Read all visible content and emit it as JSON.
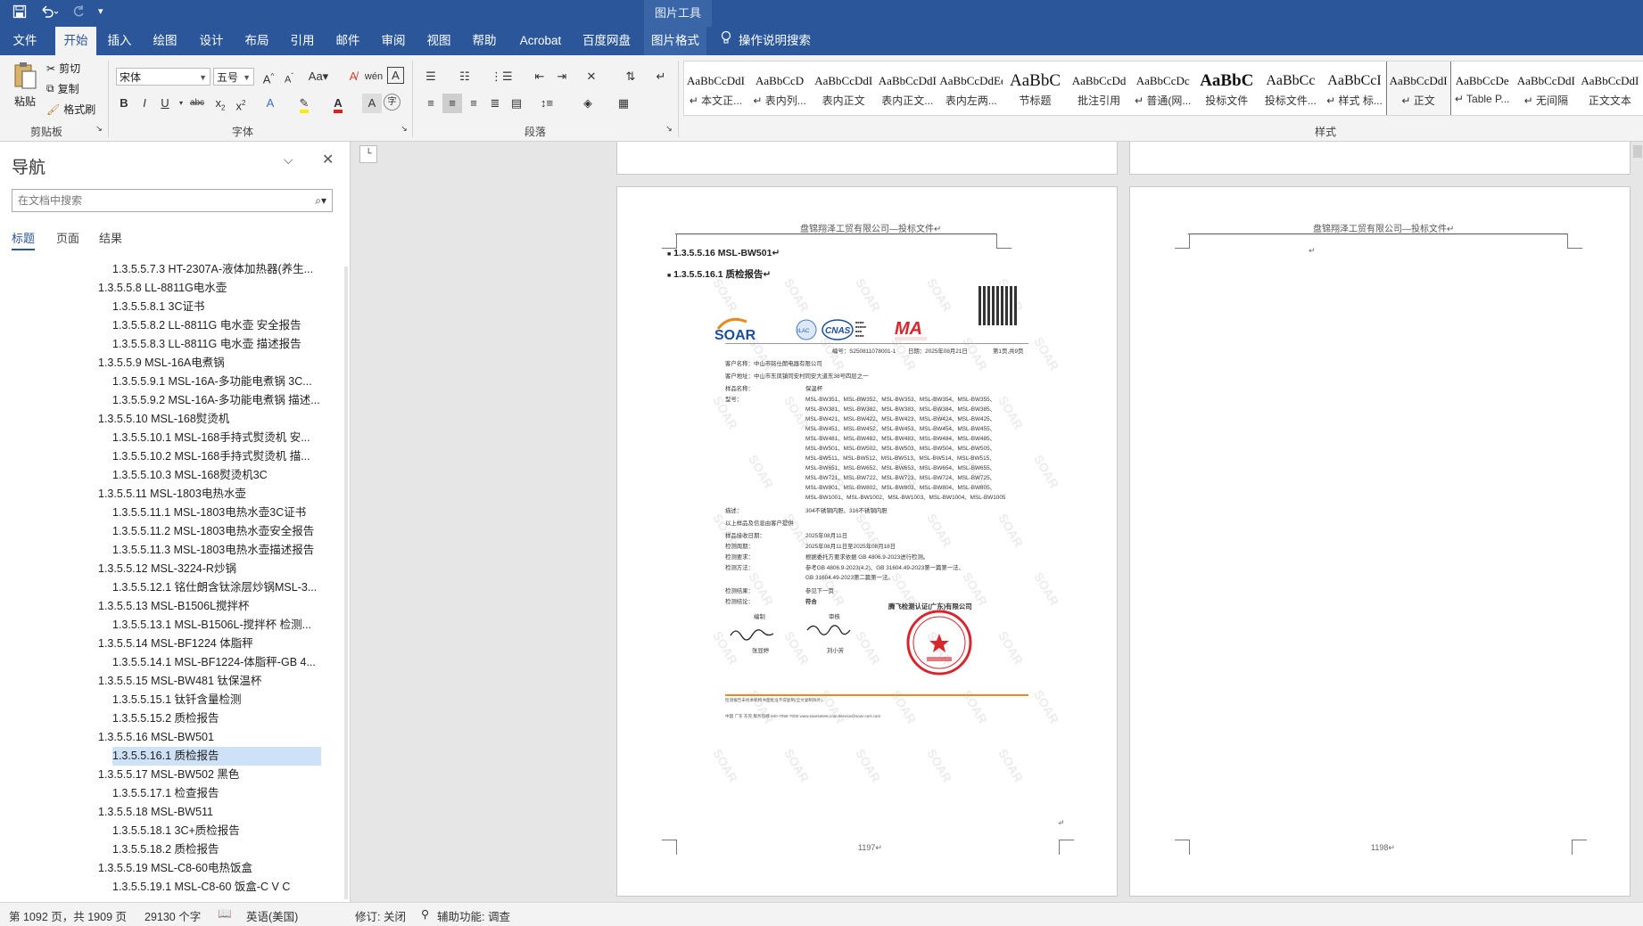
{
  "window": {
    "context_tab_group": "图片工具",
    "quick_access": [
      "save-icon",
      "undo-icon",
      "redo-icon",
      "customize-icon"
    ]
  },
  "tabs": [
    "文件",
    "开始",
    "插入",
    "绘图",
    "设计",
    "布局",
    "引用",
    "邮件",
    "审阅",
    "视图",
    "帮助",
    "Acrobat",
    "百度网盘",
    "图片格式"
  ],
  "tell_me": "操作说明搜索",
  "ribbon": {
    "clipboard": {
      "paste": "粘贴",
      "cut": "剪切",
      "copy": "复制",
      "format_painter": "格式刷",
      "label": "剪贴板"
    },
    "font": {
      "name": "宋体",
      "size": "五号",
      "label": "字体"
    },
    "paragraph": {
      "label": "段落"
    },
    "styles": {
      "label": "样式",
      "items": [
        {
          "preview": "AaBbCcDdI",
          "name": "↵ 本文正..."
        },
        {
          "preview": "AaBbCcD",
          "name": "↵ 表内列..."
        },
        {
          "preview": "AaBbCcDdI",
          "name": "表内正文"
        },
        {
          "preview": "AaBbCcDdI",
          "name": "表内正文..."
        },
        {
          "preview": "AaBbCcDdEe",
          "name": "表内左两..."
        },
        {
          "preview": "AaBbC",
          "name": "节标题"
        },
        {
          "preview": "AaBbCcDd",
          "name": "批注引用"
        },
        {
          "preview": "AaBbCcDc",
          "name": "↵ 普通(网..."
        },
        {
          "preview": "AaBbC",
          "name": "投标文件"
        },
        {
          "preview": "AaBbCc",
          "name": "投标文件..."
        },
        {
          "preview": "AaBbCcI",
          "name": "↵ 样式 标..."
        },
        {
          "preview": "AaBbCcDdI",
          "name": "↵ 正文"
        },
        {
          "preview": "AaBbCcDe",
          "name": "↵ Table P..."
        },
        {
          "preview": "AaBbCcDdI",
          "name": "↵ 无间隔"
        },
        {
          "preview": "AaBbCcDdI",
          "name": "正文文本"
        }
      ]
    }
  },
  "nav": {
    "title": "导航",
    "search_placeholder": "在文档中搜索",
    "tabs": [
      "标题",
      "页面",
      "结果"
    ],
    "items": [
      {
        "text": "1.3.5.5.7.3 HT-2307A-液体加热器(养生...",
        "level": 2
      },
      {
        "text": "1.3.5.5.8 LL-8811G电水壶",
        "level": 1
      },
      {
        "text": "1.3.5.5.8.1 3C证书",
        "level": 2
      },
      {
        "text": "1.3.5.5.8.2 LL-8811G 电水壶 安全报告",
        "level": 2
      },
      {
        "text": "1.3.5.5.8.3 LL-8811G 电水壶 描述报告",
        "level": 2
      },
      {
        "text": "1.3.5.5.9 MSL-16A电煮锅",
        "level": 1
      },
      {
        "text": "1.3.5.5.9.1 MSL-16A-多功能电煮锅 3C...",
        "level": 2
      },
      {
        "text": "1.3.5.5.9.2 MSL-16A-多功能电煮锅 描述...",
        "level": 2
      },
      {
        "text": "1.3.5.5.10 MSL-168熨烫机",
        "level": 1
      },
      {
        "text": "1.3.5.5.10.1 MSL-168手持式熨烫机 安...",
        "level": 2
      },
      {
        "text": "1.3.5.5.10.2 MSL-168手持式熨烫机 描...",
        "level": 2
      },
      {
        "text": "1.3.5.5.10.3 MSL-168熨烫机3C",
        "level": 2
      },
      {
        "text": "1.3.5.5.11 MSL-1803电热水壶",
        "level": 1
      },
      {
        "text": "1.3.5.5.11.1 MSL-1803电热水壶3C证书",
        "level": 2
      },
      {
        "text": "1.3.5.5.11.2 MSL-1803电热水壶安全报告",
        "level": 2
      },
      {
        "text": "1.3.5.5.11.3 MSL-1803电热水壶描述报告",
        "level": 2
      },
      {
        "text": "1.3.5.5.12 MSL-3224-R炒锅",
        "level": 1
      },
      {
        "text": "1.3.5.5.12.1 铭仕朗含钛涂层炒锅MSL-3...",
        "level": 2
      },
      {
        "text": "1.3.5.5.13 MSL-B1506L搅拌杯",
        "level": 1
      },
      {
        "text": "1.3.5.5.13.1 MSL-B1506L-搅拌杯 检测...",
        "level": 2
      },
      {
        "text": "1.3.5.5.14 MSL-BF1224 体脂秤",
        "level": 1
      },
      {
        "text": "1.3.5.5.14.1 MSL-BF1224-体脂秤-GB 4...",
        "level": 2
      },
      {
        "text": "1.3.5.5.15 MSL-BW481 钛保温杯",
        "level": 1
      },
      {
        "text": "1.3.5.5.15.1 钛钎含量检测",
        "level": 2
      },
      {
        "text": "1.3.5.5.15.2 质检报告",
        "level": 2
      },
      {
        "text": "1.3.5.5.16 MSL-BW501",
        "level": 1
      },
      {
        "text": "1.3.5.5.16.1 质检报告",
        "level": 2,
        "selected": true
      },
      {
        "text": "1.3.5.5.17 MSL-BW502 黑色",
        "level": 1
      },
      {
        "text": "1.3.5.5.17.1 检查报告",
        "level": 2
      },
      {
        "text": "1.3.5.5.18 MSL-BW511",
        "level": 1
      },
      {
        "text": "1.3.5.5.18.1 3C+质检报告",
        "level": 2
      },
      {
        "text": "1.3.5.5.18.2 质检报告",
        "level": 2
      },
      {
        "text": "1.3.5.5.19 MSL-C8-60电热饭盒",
        "level": 1
      },
      {
        "text": "1.3.5.5.19.1 MSL-C8-60 饭盒-C V C",
        "level": 2
      }
    ]
  },
  "document": {
    "header_text": "盘锦翔泽工贸有限公司—投标文件↵",
    "heading1": "1.3.5.5.16 MSL-BW501↵",
    "heading2": "1.3.5.5.16.1  质检报告↵",
    "page_left_number": "1197↵",
    "page_right_number": "1198↵",
    "empty_para": "↵",
    "cert": {
      "brand": "SOAR",
      "watermark": "SOAR",
      "report_no": "编号：S250811078001-1",
      "date": "日期：2025年08月21日",
      "page": "第1页,共9页",
      "client": "客户名称：中山市铭仕朗电器有限公司",
      "address": "客户地址：中山市东凤镇同安村同安大道东38号四层之一",
      "sample_name_label": "样品名称：",
      "sample_name": "保温杯",
      "model_label": "型号：",
      "models": [
        "MSL-BW351、MSL-BW352、MSL-BW353、MSL-BW354、MSL-BW355、",
        "MSL-BW381、MSL-BW382、MSL-BW383、MSL-BW384、MSL-BW385、",
        "MSL-BW421、MSL-BW422、MSL-BW423、MSL-BW424、MSL-BW425、",
        "MSL-BW451、MSL-BW452、MSL-BW453、MSL-BW454、MSL-BW455、",
        "MSL-BW481、MSL-BW482、MSL-BW483、MSL-BW484、MSL-BW485、",
        "MSL-BW501、MSL-BW502、MSL-BW503、MSL-BW504、MSL-BW505、",
        "MSL-BW511、MSL-BW512、MSL-BW513、MSL-BW514、MSL-BW515、",
        "MSL-BW651、MSL-BW652、MSL-BW653、MSL-BW654、MSL-BW655、",
        "MSL-BW721、MSL-BW722、MSL-BW723、MSL-BW724、MSL-BW725、",
        "MSL-BW801、MSL-BW802、MSL-BW803、MSL-BW804、MSL-BW805、",
        "MSL-BW1001、MSL-BW1002、MSL-BW1003、MSL-BW1004、MSL-BW1005"
      ],
      "desc_label": "描述：",
      "desc": "304不锈钢内胆、316不锈钢内胆",
      "note": "以上样品及信息由客户提供",
      "recv_label": "样品接收日期：",
      "recv": "2025年08月11日",
      "period_label": "检测周期：",
      "period": "2025年08月11日至2025年08月18日",
      "req_label": "检测要求：",
      "req": "根据委托方要求依据 GB 4806.9-2023进行检测。",
      "method_label": "检测方法：",
      "method1": "参考GB 4806.9-2023(4.2)、GB 31604.49-2023第一篇第一法、",
      "method2": "GB 31604.49-2023第二篇第一法。",
      "result_label": "检测结果：",
      "result": "参见下一页",
      "conclusion_label": "检测结论：",
      "conclusion": "符合",
      "company": "腾飞检测认证(广东)有限公司",
      "editor_label": "编制",
      "editor": "张显婷",
      "reviewer_label": "审核",
      "reviewer": "刘小芳",
      "footer1": "检测报告未经本机构书面批准不得复制(全文复制除外)...",
      "footer2": "中国 广东 东莞 服务热线 400-7055-7000 www.soarsetest.com service@soar-cert.com"
    }
  },
  "statusbar": {
    "page": "第 1092 页，共 1909 页",
    "words": "29130 个字",
    "lang": "英语(美国)",
    "track": "修订: 关闭",
    "accessibility": "辅助功能: 调查"
  },
  "colors": {
    "accent": "#2b579a",
    "selection": "#cde1f7",
    "stamp": "#d8262d"
  }
}
